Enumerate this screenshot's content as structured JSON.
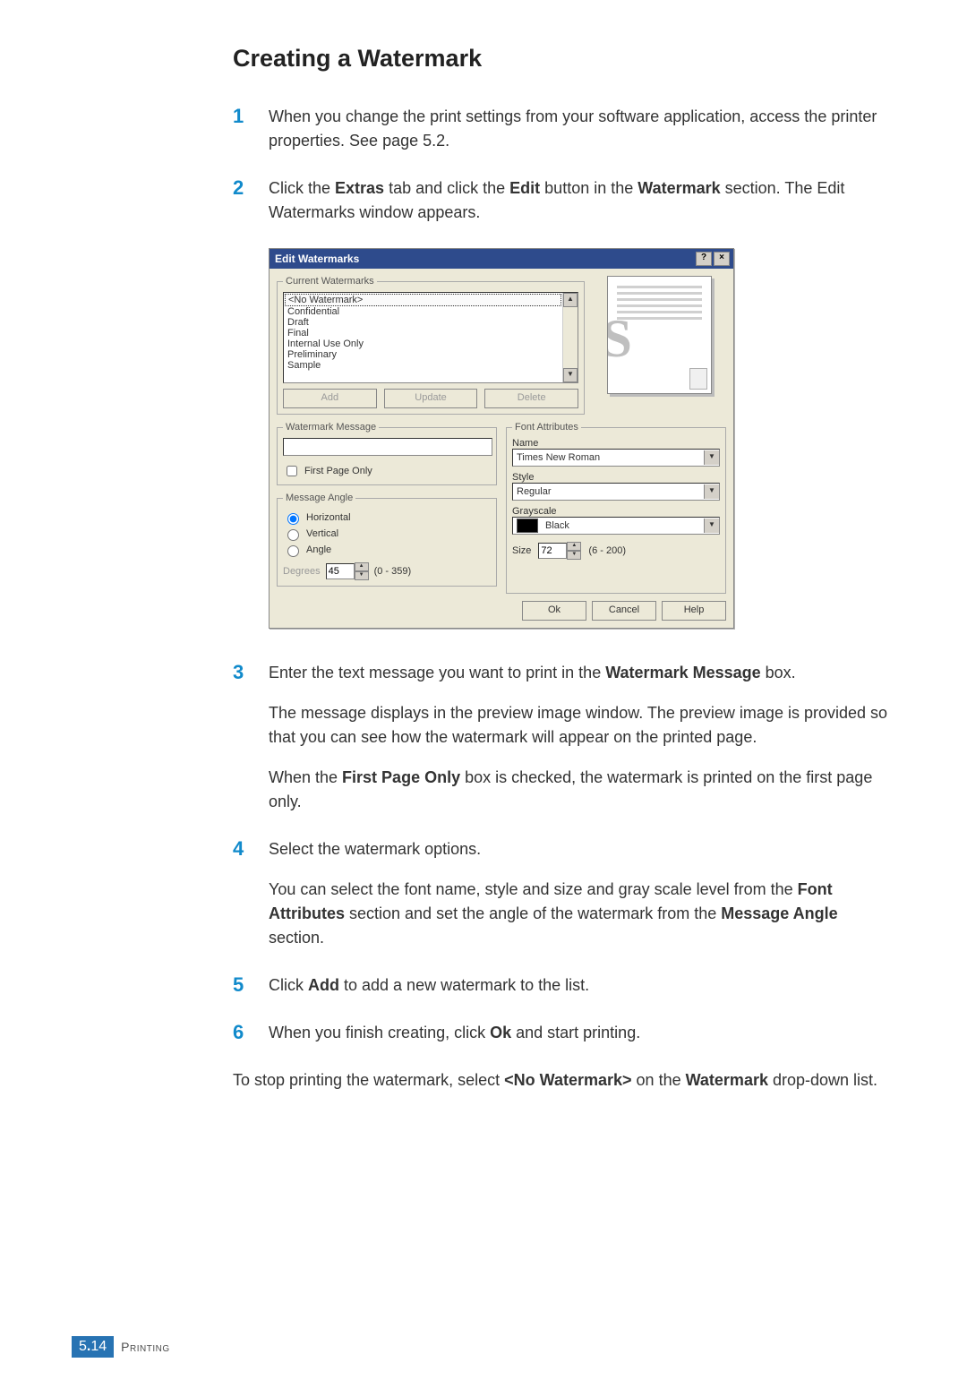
{
  "heading": "Creating a Watermark",
  "steps": {
    "s1": {
      "num": "1",
      "text": "When you change the print settings from your software application, access the printer properties. See page 5.2."
    },
    "s2": {
      "num": "2",
      "t_a": "Click the ",
      "t_b": "Extras",
      "t_c": " tab and click the ",
      "t_d": "Edit",
      "t_e": " button in the ",
      "t_f": "Watermark",
      "t_g": " section. The Edit Watermarks window appears."
    },
    "s3": {
      "num": "3",
      "p1_a": "Enter the text message you want to print in the ",
      "p1_b": "Watermark Message",
      "p1_c": " box.",
      "p2": "The message displays in the preview image window. The preview image is provided so that you can see how the watermark will appear on the printed page.",
      "p3_a": "When the ",
      "p3_b": "First Page Only",
      "p3_c": " box is checked, the watermark is printed on the first page only."
    },
    "s4": {
      "num": "4",
      "p1": "Select the watermark options.",
      "p2_a": "You can select the font name, style and size and gray scale level from the ",
      "p2_b": "Font Attributes",
      "p2_c": " section and set the angle of the watermark from the ",
      "p2_d": "Message Angle",
      "p2_e": " section."
    },
    "s5": {
      "num": "5",
      "t_a": "Click ",
      "t_b": "Add",
      "t_c": " to add a new watermark to the list."
    },
    "s6": {
      "num": "6",
      "t_a": "When you finish creating, click ",
      "t_b": "Ok",
      "t_c": " and start printing."
    }
  },
  "tail": {
    "a": "To stop printing the watermark, select ",
    "b": "<No Watermark>",
    "c": " on the ",
    "d": "Watermark",
    "e": " drop-down list."
  },
  "dialog": {
    "title": "Edit Watermarks",
    "help_btn": "?",
    "close_btn": "×",
    "current_watermarks_legend": "Current Watermarks",
    "list": {
      "0": "<No Watermark>",
      "1": "Confidential",
      "2": "Draft",
      "3": "Final",
      "4": "Internal Use Only",
      "5": "Preliminary",
      "6": "Sample"
    },
    "scroll_up": "▲",
    "scroll_down": "▼",
    "add_btn": "Add",
    "update_btn": "Update",
    "delete_btn": "Delete",
    "preview_letter": "S",
    "watermark_message_legend": "Watermark Message",
    "first_page_only": "First Page Only",
    "message_angle_legend": "Message Angle",
    "radio_horizontal": "Horizontal",
    "radio_vertical": "Vertical",
    "radio_angle": "Angle",
    "degrees_label": "Degrees",
    "degrees_value": "45",
    "degrees_range": "(0 - 359)",
    "font_attributes_legend": "Font Attributes",
    "name_label": "Name",
    "name_value": "Times New Roman",
    "style_label": "Style",
    "style_value": "Regular",
    "grayscale_label": "Grayscale",
    "grayscale_value": "Black",
    "size_label": "Size",
    "size_value": "72",
    "size_range": "(6 - 200)",
    "ok_btn": "Ok",
    "cancel_btn": "Cancel",
    "help_footer_btn": "Help"
  },
  "footer": {
    "page_a": "5",
    "page_dot": ".",
    "page_b": "14",
    "chapter": "Printing"
  }
}
